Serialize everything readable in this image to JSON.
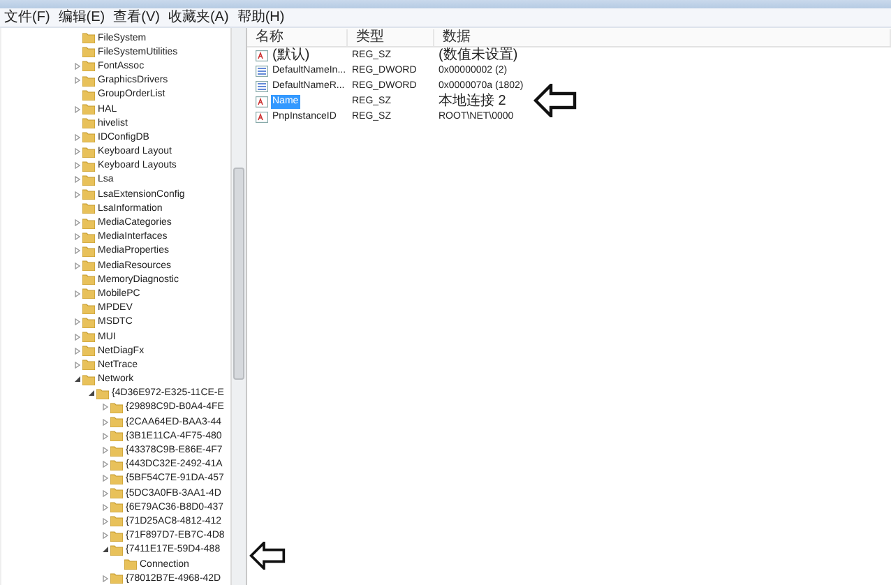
{
  "menu": [
    {
      "label": "文件(F)"
    },
    {
      "label": "编辑(E)"
    },
    {
      "label": "查看(V)"
    },
    {
      "label": "收藏夹(A)"
    },
    {
      "label": "帮助(H)"
    }
  ],
  "tree": [
    {
      "label": "FileSystem",
      "kind": "leaf"
    },
    {
      "label": "FileSystemUtilities",
      "kind": "leaf"
    },
    {
      "label": "FontAssoc",
      "kind": "branch",
      "expanded": false
    },
    {
      "label": "GraphicsDrivers",
      "kind": "branch",
      "expanded": false
    },
    {
      "label": "GroupOrderList",
      "kind": "leaf"
    },
    {
      "label": "HAL",
      "kind": "branch",
      "expanded": false
    },
    {
      "label": "hivelist",
      "kind": "leaf"
    },
    {
      "label": "IDConfigDB",
      "kind": "branch",
      "expanded": false
    },
    {
      "label": "Keyboard Layout",
      "kind": "branch",
      "expanded": false
    },
    {
      "label": "Keyboard Layouts",
      "kind": "branch",
      "expanded": false
    },
    {
      "label": "Lsa",
      "kind": "branch",
      "expanded": false
    },
    {
      "label": "LsaExtensionConfig",
      "kind": "branch",
      "expanded": false
    },
    {
      "label": "LsaInformation",
      "kind": "leaf"
    },
    {
      "label": "MediaCategories",
      "kind": "branch",
      "expanded": false
    },
    {
      "label": "MediaInterfaces",
      "kind": "branch",
      "expanded": false
    },
    {
      "label": "MediaProperties",
      "kind": "branch",
      "expanded": false
    },
    {
      "label": "MediaResources",
      "kind": "branch",
      "expanded": false
    },
    {
      "label": "MemoryDiagnostic",
      "kind": "leaf"
    },
    {
      "label": "MobilePC",
      "kind": "branch",
      "expanded": false
    },
    {
      "label": "MPDEV",
      "kind": "leaf"
    },
    {
      "label": "MSDTC",
      "kind": "branch",
      "expanded": false
    },
    {
      "label": "MUI",
      "kind": "branch",
      "expanded": false
    },
    {
      "label": "NetDiagFx",
      "kind": "branch",
      "expanded": false
    },
    {
      "label": "NetTrace",
      "kind": "branch",
      "expanded": false
    },
    {
      "label": "Network",
      "kind": "branch",
      "expanded": true,
      "children": [
        {
          "label": "{4D36E972-E325-11CE-E",
          "kind": "branch",
          "expanded": true,
          "children": [
            {
              "label": "{29898C9D-B0A4-4FE",
              "kind": "branch",
              "expanded": false
            },
            {
              "label": "{2CAA64ED-BAA3-44",
              "kind": "branch",
              "expanded": false
            },
            {
              "label": "{3B1E11CA-4F75-480",
              "kind": "branch",
              "expanded": false
            },
            {
              "label": "{43378C9B-E86E-4F7",
              "kind": "branch",
              "expanded": false
            },
            {
              "label": "{443DC32E-2492-41A",
              "kind": "branch",
              "expanded": false
            },
            {
              "label": "{5BF54C7E-91DA-457",
              "kind": "branch",
              "expanded": false
            },
            {
              "label": "{5DC3A0FB-3AA1-4D",
              "kind": "branch",
              "expanded": false
            },
            {
              "label": "{6E79AC36-B8D0-437",
              "kind": "branch",
              "expanded": false
            },
            {
              "label": "{71D25AC8-4812-412",
              "kind": "branch",
              "expanded": false
            },
            {
              "label": "{71F897D7-EB7C-4D8",
              "kind": "branch",
              "expanded": false
            },
            {
              "label": "{7411E17E-59D4-488",
              "kind": "branch",
              "expanded": true,
              "children": [
                {
                  "label": "Connection",
                  "kind": "leaf"
                }
              ]
            },
            {
              "label": "{78012B7E-4968-42D",
              "kind": "branch",
              "expanded": false
            }
          ]
        }
      ]
    }
  ],
  "columns": [
    {
      "label": "名称"
    },
    {
      "label": "类型"
    },
    {
      "label": "数据"
    }
  ],
  "values": [
    {
      "name": "(默认)",
      "type": "REG_SZ",
      "data": "(数值未设置)",
      "kind": "string",
      "selected": false
    },
    {
      "name": "DefaultNameIn...",
      "type": "REG_DWORD",
      "data": "0x00000002 (2)",
      "kind": "dword",
      "selected": false
    },
    {
      "name": "DefaultNameR...",
      "type": "REG_DWORD",
      "data": "0x0000070a (1802)",
      "kind": "dword",
      "selected": false
    },
    {
      "name": "Name",
      "type": "REG_SZ",
      "data": "本地连接 2",
      "kind": "string",
      "selected": true
    },
    {
      "name": "PnpInstanceID",
      "type": "REG_SZ",
      "data": "ROOT\\NET\\0000",
      "kind": "string",
      "selected": false
    }
  ]
}
